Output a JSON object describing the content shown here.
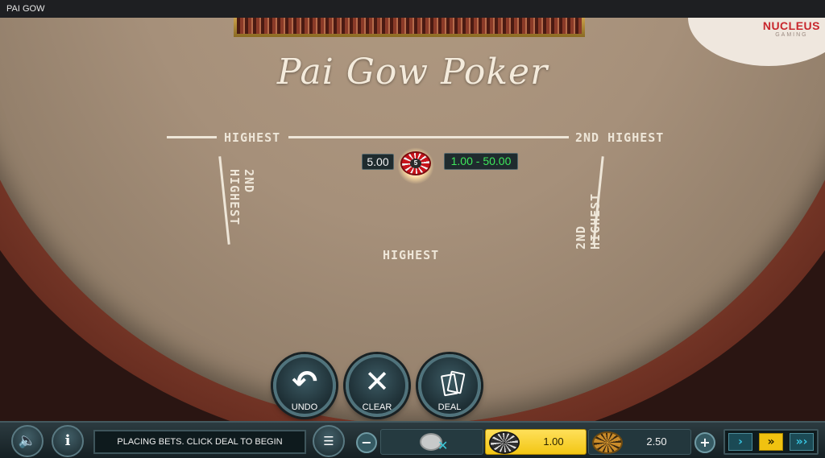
{
  "window": {
    "title": "PAI GOW"
  },
  "brand": {
    "name": "NUCLEUS",
    "sub": "GAMING"
  },
  "table": {
    "title": "Pai Gow Poker",
    "labels": {
      "top_left": "HIGHEST",
      "top_right": "2ND HIGHEST",
      "left_side": "2ND HIGHEST",
      "right_side": "2ND HIGHEST",
      "bottom": "HIGHEST"
    },
    "bet": {
      "stake": "5.00",
      "chip_value": "5",
      "range": "1.00 - 50.00"
    }
  },
  "actions": {
    "undo_label": "UNDO",
    "clear_label": "CLEAR",
    "deal_label": "DEAL",
    "undo_icon": "undo-arrow-icon",
    "clear_icon": "x-icon",
    "deal_icon": "cards-icon"
  },
  "bottom_bar": {
    "status": "PLACING BETS. CLICK DEAL TO BEGIN",
    "chips": [
      {
        "value": "1.00",
        "selected": true
      },
      {
        "value": "2.50",
        "selected": false
      }
    ],
    "icons": {
      "sound": "speaker-icon",
      "info": "info-icon",
      "menu": "menu-clear-icon",
      "minus": "minus-icon",
      "plus": "plus-icon"
    },
    "speeds": [
      "›",
      "»",
      "»›"
    ]
  },
  "colors": {
    "felt": "#a6907a",
    "rail": "#6a2c20",
    "accent_yellow": "#f2c614",
    "range_green": "#3ee85b",
    "brand_red": "#c8262c"
  }
}
